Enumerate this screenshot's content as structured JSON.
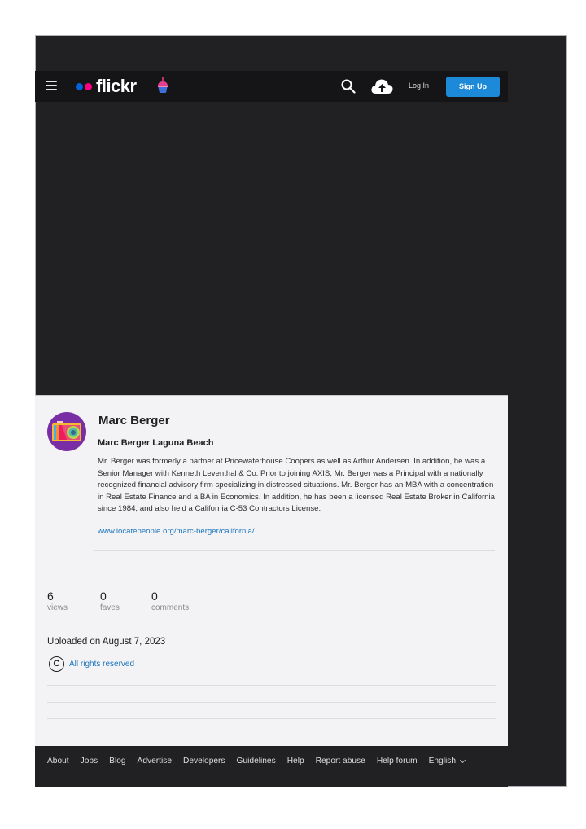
{
  "header": {
    "logo_text": "flickr",
    "login_label": "Log In",
    "signup_label": "Sign Up",
    "icons": {
      "menu": "hamburger-menu-icon",
      "search": "search-icon",
      "upload": "cloud-upload-icon",
      "special": "cupcake-icon"
    },
    "colors": {
      "logo_blue": "#0063dc",
      "logo_pink": "#ff0084",
      "signup_bg": "#1c8ad8"
    }
  },
  "photo_info": {
    "owner_name": "Marc Berger",
    "title": "Marc Berger Laguna Beach",
    "description": "Mr. Berger was formerly a partner at Pricewaterhouse Coopers as well as Arthur Andersen. In addition, he was a Senior Manager with Kenneth Leventhal & Co. Prior to joining AXIS, Mr. Berger was a Principal with a nationally recognized financial advisory firm specializing in distressed situations. Mr. Berger has an MBA with a concentration in Real Estate Finance and a BA in Economics. In addition, he has been a licensed Real Estate Broker in California since 1984, and also held a California C-53 Contractors License.",
    "link": "www.locatepeople.org/marc-berger/california/",
    "stats": [
      {
        "value": "6",
        "label": "views"
      },
      {
        "value": "0",
        "label": "faves"
      },
      {
        "value": "0",
        "label": "comments"
      }
    ],
    "uploaded": "Uploaded on August 7, 2023",
    "license_icon": "C",
    "license": "All rights reserved"
  },
  "footer": {
    "links": [
      "About",
      "Jobs",
      "Blog",
      "Advertise",
      "Developers",
      "Guidelines",
      "Help",
      "Report abuse",
      "Help forum"
    ],
    "language": "English"
  }
}
